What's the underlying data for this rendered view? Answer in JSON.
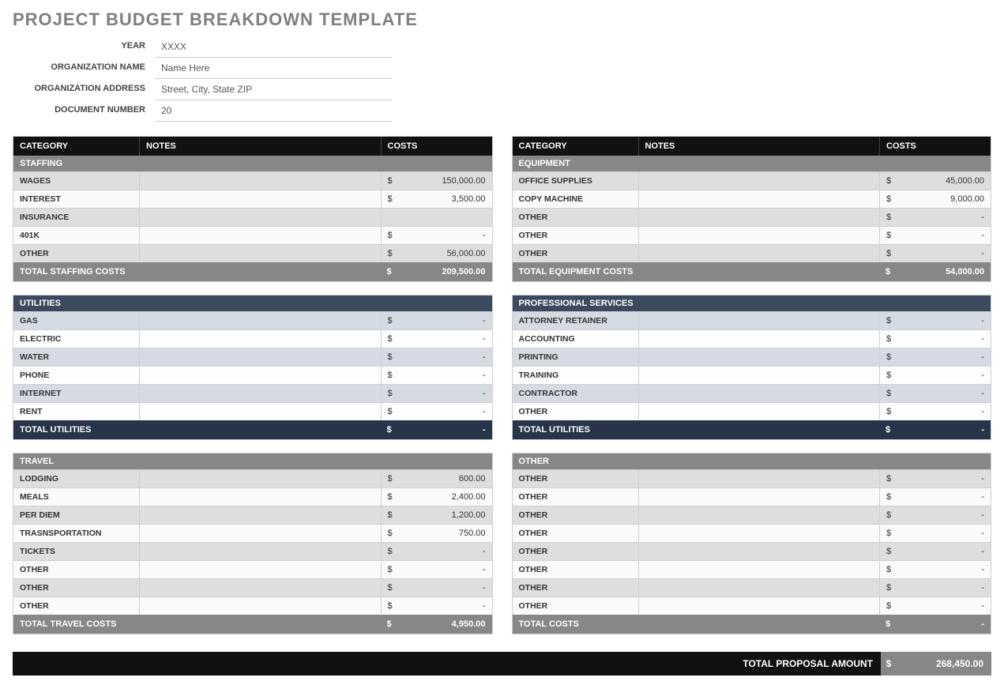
{
  "title": "PROJECT BUDGET BREAKDOWN TEMPLATE",
  "info": {
    "year_label": "YEAR",
    "year_value": "XXXX",
    "org_label": "ORGANIZATION NAME",
    "org_value": "Name Here",
    "addr_label": "ORGANIZATION ADDRESS",
    "addr_value": "Street, City, State ZIP",
    "doc_label": "DOCUMENT NUMBER",
    "doc_value": "20"
  },
  "headers": {
    "category": "CATEGORY",
    "notes": "NOTES",
    "costs": "COSTS"
  },
  "currency": "$",
  "left": [
    {
      "style": "gray",
      "sub": "STAFFING",
      "total_label": "TOTAL STAFFING COSTS",
      "total": "209,500.00",
      "rows": [
        {
          "label": "WAGES",
          "notes": "",
          "sym": "$",
          "amt": "150,000.00"
        },
        {
          "label": "INTEREST",
          "notes": "",
          "sym": "$",
          "amt": "3,500.00"
        },
        {
          "label": "INSURANCE",
          "notes": "",
          "sym": "",
          "amt": ""
        },
        {
          "label": "401K",
          "notes": "",
          "sym": "$",
          "amt": "-"
        },
        {
          "label": "OTHER",
          "notes": "",
          "sym": "$",
          "amt": "56,000.00"
        }
      ]
    },
    {
      "style": "blue",
      "sub": "UTILITIES",
      "total_label": "TOTAL UTILITIES",
      "total": "-",
      "rows": [
        {
          "label": "GAS",
          "notes": "",
          "sym": "$",
          "amt": "-"
        },
        {
          "label": "ELECTRIC",
          "notes": "",
          "sym": "$",
          "amt": "-"
        },
        {
          "label": "WATER",
          "notes": "",
          "sym": "$",
          "amt": "-"
        },
        {
          "label": "PHONE",
          "notes": "",
          "sym": "$",
          "amt": "-"
        },
        {
          "label": "INTERNET",
          "notes": "",
          "sym": "$",
          "amt": "-"
        },
        {
          "label": "RENT",
          "notes": "",
          "sym": "$",
          "amt": "-"
        }
      ]
    },
    {
      "style": "gray",
      "sub": "TRAVEL",
      "total_label": "TOTAL TRAVEL COSTS",
      "total": "4,950.00",
      "rows": [
        {
          "label": "LODGING",
          "notes": "",
          "sym": "$",
          "amt": "600.00"
        },
        {
          "label": "MEALS",
          "notes": "",
          "sym": "$",
          "amt": "2,400.00"
        },
        {
          "label": "PER DIEM",
          "notes": "",
          "sym": "$",
          "amt": "1,200.00"
        },
        {
          "label": "TRASNSPORTATION",
          "notes": "",
          "sym": "$",
          "amt": "750.00"
        },
        {
          "label": "TICKETS",
          "notes": "",
          "sym": "$",
          "amt": "-"
        },
        {
          "label": "OTHER",
          "notes": "",
          "sym": "$",
          "amt": "-"
        },
        {
          "label": "OTHER",
          "notes": "",
          "sym": "$",
          "amt": "-"
        },
        {
          "label": "OTHER",
          "notes": "",
          "sym": "$",
          "amt": "-"
        }
      ]
    }
  ],
  "right": [
    {
      "style": "gray",
      "sub": "EQUIPMENT",
      "total_label": "TOTAL EQUIPMENT COSTS",
      "total": "54,000.00",
      "rows": [
        {
          "label": "OFFICE SUPPLIES",
          "notes": "",
          "sym": "$",
          "amt": "45,000.00"
        },
        {
          "label": "COPY MACHINE",
          "notes": "",
          "sym": "$",
          "amt": "9,000.00"
        },
        {
          "label": "OTHER",
          "notes": "",
          "sym": "$",
          "amt": "-"
        },
        {
          "label": "OTHER",
          "notes": "",
          "sym": "$",
          "amt": "-"
        },
        {
          "label": "OTHER",
          "notes": "",
          "sym": "$",
          "amt": "-"
        }
      ]
    },
    {
      "style": "blue",
      "sub": "PROFESSIONAL SERVICES",
      "total_label": "TOTAL UTILITIES",
      "total": "-",
      "rows": [
        {
          "label": "ATTORNEY RETAINER",
          "notes": "",
          "sym": "$",
          "amt": "-"
        },
        {
          "label": "ACCOUNTING",
          "notes": "",
          "sym": "$",
          "amt": "-"
        },
        {
          "label": "PRINTING",
          "notes": "",
          "sym": "$",
          "amt": "-"
        },
        {
          "label": "TRAINING",
          "notes": "",
          "sym": "$",
          "amt": "-"
        },
        {
          "label": "CONTRACTOR",
          "notes": "",
          "sym": "$",
          "amt": "-"
        },
        {
          "label": "OTHER",
          "notes": "",
          "sym": "$",
          "amt": "-"
        }
      ]
    },
    {
      "style": "gray",
      "sub": "OTHER",
      "total_label": "TOTAL COSTS",
      "total": "-",
      "rows": [
        {
          "label": "OTHER",
          "notes": "",
          "sym": "$",
          "amt": "-"
        },
        {
          "label": "OTHER",
          "notes": "",
          "sym": "$",
          "amt": "-"
        },
        {
          "label": "OTHER",
          "notes": "",
          "sym": "$",
          "amt": "-"
        },
        {
          "label": "OTHER",
          "notes": "",
          "sym": "$",
          "amt": "-"
        },
        {
          "label": "OTHER",
          "notes": "",
          "sym": "$",
          "amt": "-"
        },
        {
          "label": "OTHER",
          "notes": "",
          "sym": "$",
          "amt": "-"
        },
        {
          "label": "OTHER",
          "notes": "",
          "sym": "$",
          "amt": "-"
        },
        {
          "label": "OTHER",
          "notes": "",
          "sym": "$",
          "amt": "-"
        }
      ]
    }
  ],
  "grand": {
    "label": "TOTAL PROPOSAL AMOUNT",
    "sym": "$",
    "amt": "268,450.00"
  }
}
